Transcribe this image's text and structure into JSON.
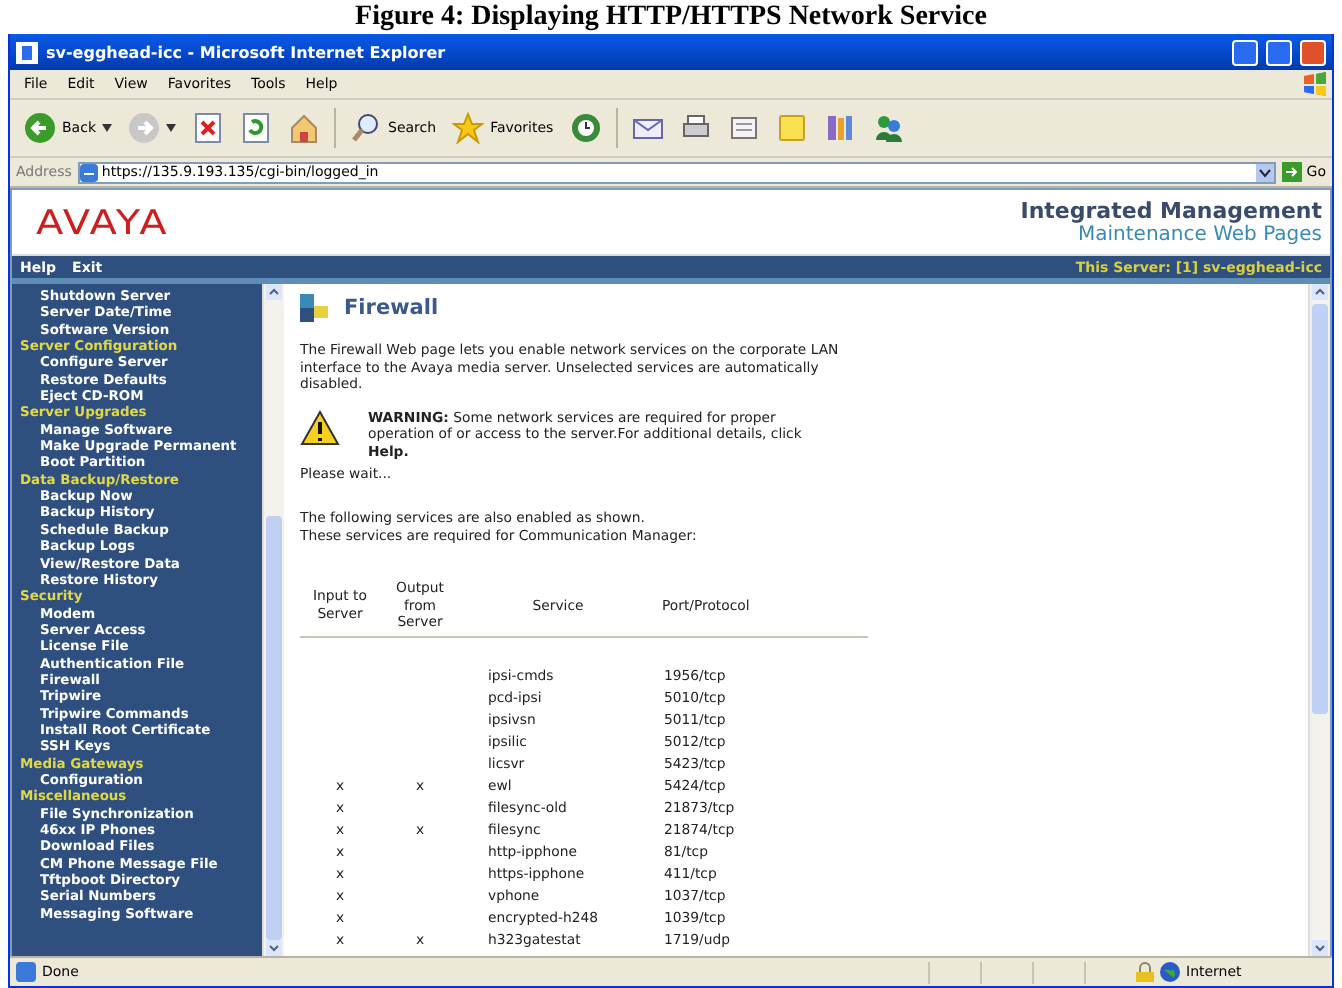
{
  "caption": "Figure 4: Displaying HTTP/HTTPS Network Service",
  "window": {
    "title": "sv-egghead-icc - Microsoft Internet Explorer"
  },
  "menu": [
    "File",
    "Edit",
    "View",
    "Favorites",
    "Tools",
    "Help"
  ],
  "toolbar": [
    {
      "kind": "back",
      "label": "Back"
    },
    {
      "kind": "forward"
    },
    {
      "kind": "stop"
    },
    {
      "kind": "refresh"
    },
    {
      "kind": "home"
    },
    {
      "kind": "search",
      "label": "Search"
    },
    {
      "kind": "favorites",
      "label": "Favorites"
    },
    {
      "kind": "history"
    },
    {
      "kind": "mail"
    },
    {
      "kind": "print"
    },
    {
      "kind": "edit"
    },
    {
      "kind": "note"
    },
    {
      "kind": "research"
    },
    {
      "kind": "messenger"
    }
  ],
  "address": {
    "label": "Address",
    "value": "https://135.9.193.135/cgi-bin/logged_in",
    "go": "Go"
  },
  "banner": {
    "logo": "AVAYA",
    "title": "Integrated Management",
    "subtitle": "Maintenance Web Pages"
  },
  "navbar": {
    "links": [
      "Help",
      "Exit"
    ],
    "server": "This Server: [1] sv-egghead-icc"
  },
  "sidebar": [
    {
      "kind": "link",
      "text": "Shutdown Server"
    },
    {
      "kind": "link",
      "text": "Server Date/Time"
    },
    {
      "kind": "link",
      "text": "Software Version"
    },
    {
      "kind": "header",
      "text": "Server Configuration"
    },
    {
      "kind": "link",
      "text": "Configure Server"
    },
    {
      "kind": "link",
      "text": "Restore Defaults"
    },
    {
      "kind": "link",
      "text": "Eject CD-ROM"
    },
    {
      "kind": "header",
      "text": "Server Upgrades"
    },
    {
      "kind": "link",
      "text": "Manage Software"
    },
    {
      "kind": "link",
      "text": "Make Upgrade Permanent"
    },
    {
      "kind": "link",
      "text": "Boot Partition"
    },
    {
      "kind": "header",
      "text": "Data Backup/Restore"
    },
    {
      "kind": "link",
      "text": "Backup Now"
    },
    {
      "kind": "link",
      "text": "Backup History"
    },
    {
      "kind": "link",
      "text": "Schedule Backup"
    },
    {
      "kind": "link",
      "text": "Backup Logs"
    },
    {
      "kind": "link",
      "text": "View/Restore Data"
    },
    {
      "kind": "link",
      "text": "Restore History"
    },
    {
      "kind": "header",
      "text": "Security"
    },
    {
      "kind": "link",
      "text": "Modem"
    },
    {
      "kind": "link",
      "text": "Server Access"
    },
    {
      "kind": "link",
      "text": "License File"
    },
    {
      "kind": "link",
      "text": "Authentication File"
    },
    {
      "kind": "link",
      "text": "Firewall"
    },
    {
      "kind": "link",
      "text": "Tripwire"
    },
    {
      "kind": "link",
      "text": "Tripwire Commands"
    },
    {
      "kind": "link",
      "text": "Install Root Certificate"
    },
    {
      "kind": "link",
      "text": "SSH Keys"
    },
    {
      "kind": "header",
      "text": "Media Gateways"
    },
    {
      "kind": "link",
      "text": "Configuration"
    },
    {
      "kind": "header",
      "text": "Miscellaneous"
    },
    {
      "kind": "link",
      "text": "File Synchronization"
    },
    {
      "kind": "link",
      "text": "46xx IP Phones"
    },
    {
      "kind": "link",
      "text": "Download Files"
    },
    {
      "kind": "link",
      "text": "CM Phone Message File"
    },
    {
      "kind": "link",
      "text": "Tftpboot Directory"
    },
    {
      "kind": "link",
      "text": "Serial Numbers"
    },
    {
      "kind": "link",
      "text": "Messaging Software"
    }
  ],
  "content": {
    "title": "Firewall",
    "intro": "The Firewall Web page lets you enable network services on the corporate LAN interface to the Avaya media server. Unselected services are automatically disabled.",
    "warning": "**WARNING:** Some network services are required for proper operation of or access to the server.For additional details, click **Help.**",
    "wait": "Please wait...",
    "note": [
      "The following services are also enabled as shown.",
      "These services are required for Communication Manager:"
    ],
    "table": {
      "columns": [
        "Input to Server",
        "Output from Server",
        "Service",
        "Port/Protocol"
      ],
      "rows": [
        {
          "service": "ipsi-cmds",
          "port": "1956/tcp"
        },
        {
          "service": "pcd-ipsi",
          "port": "5010/tcp"
        },
        {
          "service": "ipsivsn",
          "port": "5011/tcp"
        },
        {
          "service": "ipsilic",
          "port": "5012/tcp"
        },
        {
          "service": "licsvr",
          "port": "5423/tcp"
        },
        {
          "input": "x",
          "output": "x",
          "service": "ewl",
          "port": "5424/tcp"
        },
        {
          "input": "x",
          "service": "filesync-old",
          "port": "21873/tcp"
        },
        {
          "input": "x",
          "output": "x",
          "service": "filesync",
          "port": "21874/tcp"
        },
        {
          "input": "x",
          "service": "http-ipphone",
          "port": "81/tcp"
        },
        {
          "input": "x",
          "service": "https-ipphone",
          "port": "411/tcp"
        },
        {
          "input": "x",
          "service": "vphone",
          "port": "1037/tcp"
        },
        {
          "input": "x",
          "service": "encrypted-h248",
          "port": "1039/tcp"
        },
        {
          "input": "x",
          "output": "x",
          "service": "h323gatestat",
          "port": "1719/udp"
        }
      ]
    }
  },
  "status": {
    "text": "Done",
    "zone": "Internet"
  }
}
